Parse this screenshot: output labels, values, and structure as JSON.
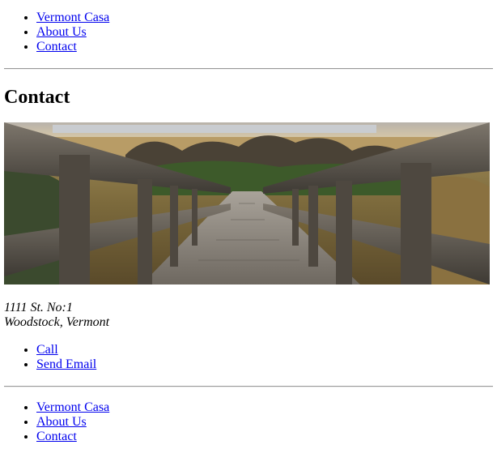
{
  "header_nav": {
    "items": [
      {
        "label": "Vermont Casa"
      },
      {
        "label": "About Us"
      },
      {
        "label": "Contact"
      }
    ]
  },
  "main": {
    "title": "Contact",
    "hero_image": {
      "depicts": "wooden-boardwalk-photo"
    },
    "address": {
      "line1": "1111 St. No:1",
      "line2": "Woodstock, Vermont"
    },
    "contact_links": [
      {
        "label": "Call"
      },
      {
        "label": "Send Email"
      }
    ]
  },
  "footer_nav": {
    "items": [
      {
        "label": "Vermont Casa"
      },
      {
        "label": "About Us"
      },
      {
        "label": "Contact"
      }
    ]
  },
  "colors": {
    "link": "#0000ee",
    "rule": "#9a9a9a",
    "text": "#000000",
    "background": "#ffffff"
  }
}
